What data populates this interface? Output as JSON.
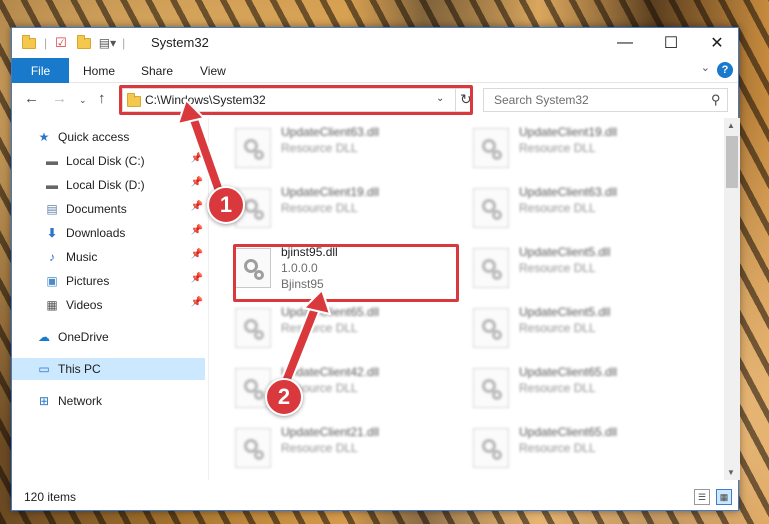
{
  "window": {
    "title": "System32",
    "controls": {
      "minimize": "—",
      "maximize": "☐",
      "close": "✕"
    }
  },
  "ribbon": {
    "tabs": [
      {
        "label": "File"
      },
      {
        "label": "Home"
      },
      {
        "label": "Share"
      },
      {
        "label": "View"
      }
    ],
    "help_label": "?"
  },
  "navigation": {
    "address": "C:\\Windows\\System32",
    "search_placeholder": "Search System32"
  },
  "sidebar": {
    "items": [
      {
        "label": "Quick access",
        "icon": "star-icon",
        "pinned": false
      },
      {
        "label": "Local Disk (C:)",
        "icon": "drive-icon",
        "pinned": true
      },
      {
        "label": "Local Disk (D:)",
        "icon": "drive-icon",
        "pinned": true
      },
      {
        "label": "Documents",
        "icon": "documents-icon",
        "pinned": true
      },
      {
        "label": "Downloads",
        "icon": "download-icon",
        "pinned": true
      },
      {
        "label": "Music",
        "icon": "music-icon",
        "pinned": true
      },
      {
        "label": "Pictures",
        "icon": "pictures-icon",
        "pinned": true
      },
      {
        "label": "Videos",
        "icon": "videos-icon",
        "pinned": true
      },
      {
        "label": "OneDrive",
        "icon": "cloud-icon",
        "pinned": false
      },
      {
        "label": "This PC",
        "icon": "computer-icon",
        "pinned": false,
        "selected": true
      },
      {
        "label": "Network",
        "icon": "network-icon",
        "pinned": false
      }
    ]
  },
  "files": {
    "left_column": [
      {
        "name": "UpdateClient63.dll",
        "desc": "Resource DLL"
      },
      {
        "name": "UpdateClient19.dll",
        "desc": "Resource DLL"
      },
      {
        "name": "bjinst95.dll",
        "desc": "1.0.0.0",
        "version": "Bjinst95"
      },
      {
        "name": "UpdateClient65.dll",
        "desc": "Resource DLL"
      },
      {
        "name": "UpdateClient42.dll",
        "desc": "Resource DLL"
      },
      {
        "name": "UpdateClient21.dll",
        "desc": "Resource DLL"
      }
    ],
    "right_column": [
      {
        "name": "UpdateClient19.dll",
        "desc": "Resource DLL"
      },
      {
        "name": "UpdateClient63.dll",
        "desc": "Resource DLL"
      },
      {
        "name": "UpdateClient5.dll",
        "desc": "Resource DLL"
      },
      {
        "name": "UpdateClient5.dll",
        "desc": "Resource DLL"
      },
      {
        "name": "UpdateClient65.dll",
        "desc": "Resource DLL"
      },
      {
        "name": "UpdateClient65.dll",
        "desc": "Resource DLL"
      }
    ]
  },
  "status": {
    "item_count": "120 items"
  },
  "annotations": {
    "callout_1": "1",
    "callout_2": "2",
    "color": "#d9393d"
  },
  "colors": {
    "accent": "#1979ca",
    "selection": "#cce8ff",
    "highlight": "#d9393d"
  }
}
